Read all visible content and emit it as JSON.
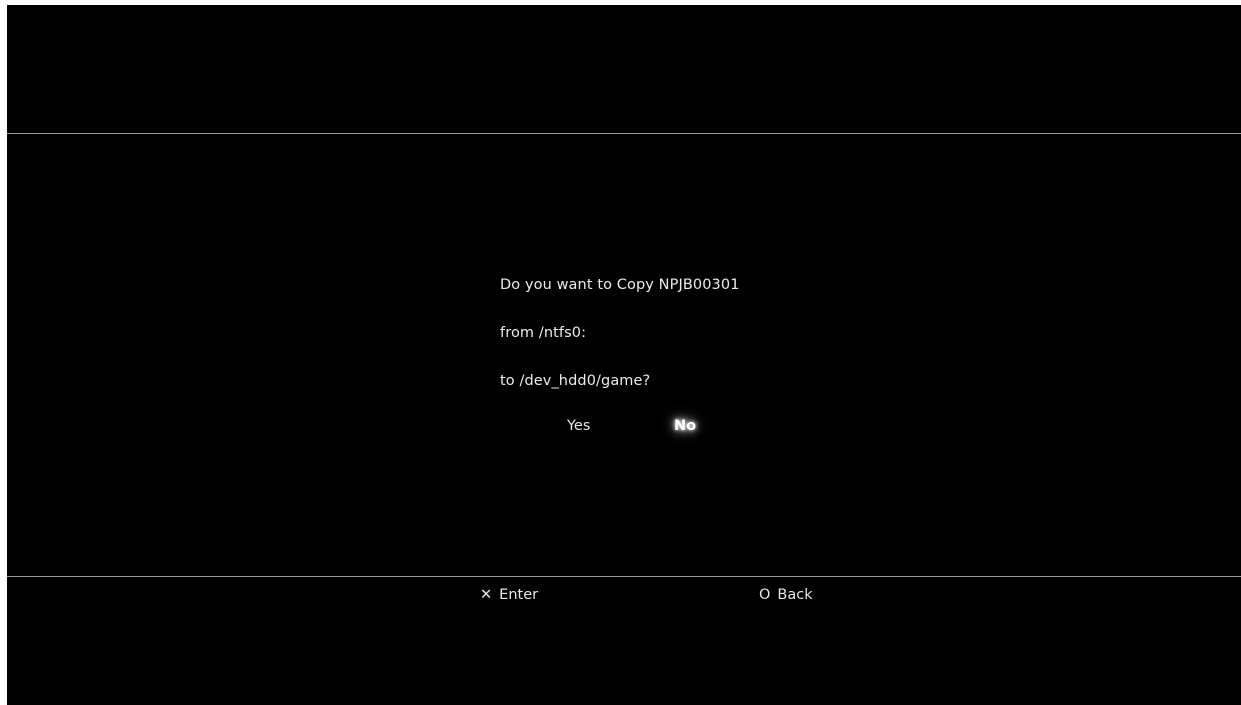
{
  "dialog": {
    "line1": "Do you want to Copy NPJB00301",
    "line2": "from /ntfs0:",
    "line3": "to /dev_hdd0/game?",
    "options": {
      "yes": "Yes",
      "no": "No",
      "selected": "No"
    }
  },
  "footer": {
    "enter": {
      "icon": "cross-icon",
      "glyph": "✕",
      "label": "Enter"
    },
    "back": {
      "icon": "circle-icon",
      "glyph": "O",
      "label": "Back"
    }
  },
  "colors": {
    "background": "#000000",
    "text": "#ececec",
    "divider": "#9a9a9a",
    "highlight_glow": "#ffffff"
  }
}
